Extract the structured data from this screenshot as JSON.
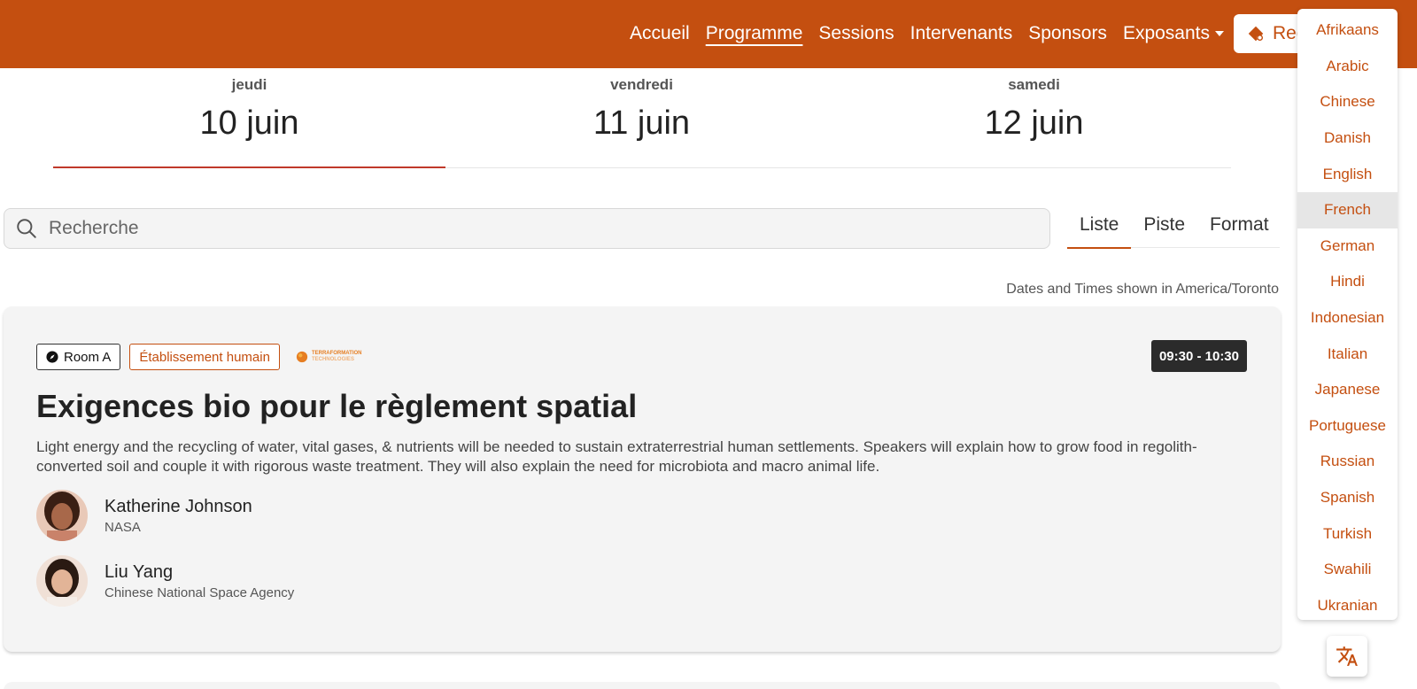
{
  "header": {
    "nav": [
      {
        "label": "Accueil",
        "active": false
      },
      {
        "label": "Programme",
        "active": true
      },
      {
        "label": "Sessions",
        "active": false
      },
      {
        "label": "Intervenants",
        "active": false
      },
      {
        "label": "Sponsors",
        "active": false
      },
      {
        "label": "Exposants",
        "active": false,
        "dropdown": true
      }
    ],
    "register_label": "Reg",
    "brand_color": "#c44f10"
  },
  "days": [
    {
      "dow": "jeudi",
      "date": "10 juin",
      "active": true
    },
    {
      "dow": "vendredi",
      "date": "11 juin",
      "active": false
    },
    {
      "dow": "samedi",
      "date": "12 juin",
      "active": false
    }
  ],
  "search": {
    "placeholder": "Recherche",
    "icon": "search-icon"
  },
  "view_tabs": [
    {
      "label": "Liste",
      "active": true
    },
    {
      "label": "Piste",
      "active": false
    },
    {
      "label": "Format",
      "active": false
    }
  ],
  "timezone_note": "Dates and Times shown in America/Toronto",
  "session": {
    "room": "Room A",
    "track": "Établissement humain",
    "sponsor_logo_text": [
      "TERRAFORMATION",
      "TECHNOLOGIES"
    ],
    "time": "09:30 - 10:30",
    "title": "Exigences bio pour le règlement spatial",
    "description": "Light energy and the recycling of water, vital gases, & nutrients will be needed to sustain extraterrestrial human settlements. Speakers will explain how to grow food in regolith-converted soil and couple it with rigorous waste treatment. They will also explain the need for microbiota and macro animal life.",
    "speakers": [
      {
        "name": "Katherine Johnson",
        "org": "NASA"
      },
      {
        "name": "Liu Yang",
        "org": "Chinese National Space Agency"
      }
    ]
  },
  "language_menu": {
    "selected": "French",
    "items": [
      "Afrikaans",
      "Arabic",
      "Chinese",
      "Danish",
      "English",
      "French",
      "German",
      "Hindi",
      "Indonesian",
      "Italian",
      "Japanese",
      "Portuguese",
      "Russian",
      "Spanish",
      "Turkish",
      "Swahili",
      "Ukranian"
    ]
  }
}
